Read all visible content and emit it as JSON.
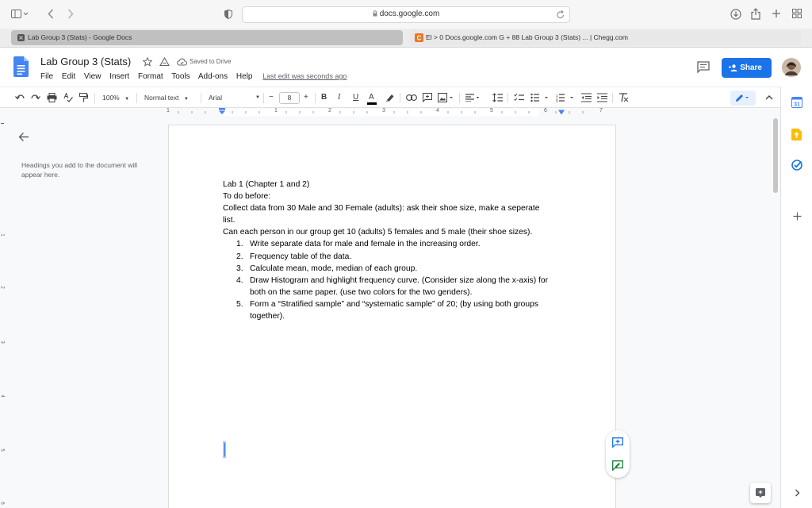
{
  "browser": {
    "url": "docs.google.com",
    "tabs": [
      {
        "label": "Lab Group 3 (Stats) - Google Docs",
        "active": true
      },
      {
        "label": "El > 0 Docs.google.com G + 88 Lab Group 3 (Stats) ... | Chegg.com",
        "active": false
      }
    ]
  },
  "doc_header": {
    "title": "Lab Group 3 (Stats)",
    "save_status": "Saved to Drive",
    "menu": [
      "File",
      "Edit",
      "View",
      "Insert",
      "Format",
      "Tools",
      "Add-ons",
      "Help"
    ],
    "last_edit": "Last edit was seconds ago",
    "share_label": "Share"
  },
  "toolbar": {
    "zoom": "100%",
    "style": "Normal text",
    "font": "Arial",
    "font_size": "8",
    "font_size_minus": "−",
    "font_size_plus": "+",
    "bold": "B",
    "italic": "I",
    "underline": "U",
    "text_color_label": "A"
  },
  "ruler": {
    "numbers": [
      "1",
      "1",
      "2",
      "3",
      "4",
      "5",
      "6",
      "7"
    ]
  },
  "left_ruler": {
    "numbers": [
      "1",
      "1",
      "2",
      "3",
      "4",
      "5",
      "6"
    ]
  },
  "outline": {
    "hint": "Headings you add to the document will appear here."
  },
  "document": {
    "lines": [
      "Lab 1 (Chapter 1 and 2)",
      "To do before:",
      "Collect data from 30 Male and 30 Female (adults): ask their shoe size, make a seperate list.",
      "Can each person in our group get 10 (adults) 5 females and 5 male (their shoe sizes)."
    ],
    "tasks": [
      {
        "num": "1.",
        "text": "Write separate data for male and female in the increasing order."
      },
      {
        "num": "2.",
        "text": "Frequency table of the data."
      },
      {
        "num": "3.",
        "text": "Calculate mean, mode, median of each group."
      },
      {
        "num": "4.",
        "text": "Draw Histogram and highlight frequency curve. (Consider size along the x-axis) for both on the same paper. (use two colors for the two genders)."
      },
      {
        "num": "5.",
        "text": "Form a “Stratified sample” and “systematic sample” of 20; (by using both groups together)."
      }
    ]
  },
  "colors": {
    "accent": "#1a73e8",
    "docs_blue": "#4285f4",
    "chegg_orange": "#e87722",
    "text_color_swatch": "#000000"
  }
}
